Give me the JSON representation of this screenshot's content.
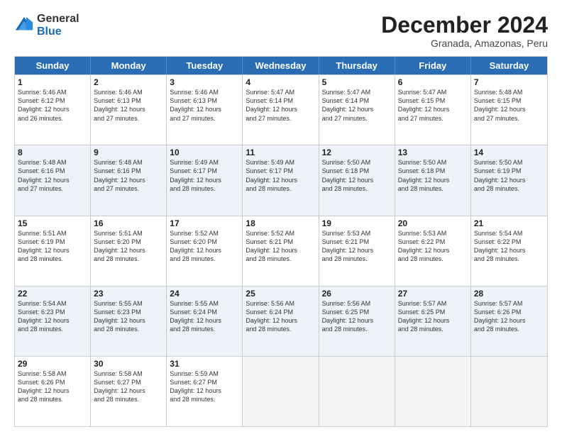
{
  "logo": {
    "general": "General",
    "blue": "Blue"
  },
  "title": "December 2024",
  "subtitle": "Granada, Amazonas, Peru",
  "header_days": [
    "Sunday",
    "Monday",
    "Tuesday",
    "Wednesday",
    "Thursday",
    "Friday",
    "Saturday"
  ],
  "weeks": [
    [
      {
        "day": "1",
        "lines": [
          "Sunrise: 5:46 AM",
          "Sunset: 6:12 PM",
          "Daylight: 12 hours",
          "and 26 minutes."
        ]
      },
      {
        "day": "2",
        "lines": [
          "Sunrise: 5:46 AM",
          "Sunset: 6:13 PM",
          "Daylight: 12 hours",
          "and 27 minutes."
        ]
      },
      {
        "day": "3",
        "lines": [
          "Sunrise: 5:46 AM",
          "Sunset: 6:13 PM",
          "Daylight: 12 hours",
          "and 27 minutes."
        ]
      },
      {
        "day": "4",
        "lines": [
          "Sunrise: 5:47 AM",
          "Sunset: 6:14 PM",
          "Daylight: 12 hours",
          "and 27 minutes."
        ]
      },
      {
        "day": "5",
        "lines": [
          "Sunrise: 5:47 AM",
          "Sunset: 6:14 PM",
          "Daylight: 12 hours",
          "and 27 minutes."
        ]
      },
      {
        "day": "6",
        "lines": [
          "Sunrise: 5:47 AM",
          "Sunset: 6:15 PM",
          "Daylight: 12 hours",
          "and 27 minutes."
        ]
      },
      {
        "day": "7",
        "lines": [
          "Sunrise: 5:48 AM",
          "Sunset: 6:15 PM",
          "Daylight: 12 hours",
          "and 27 minutes."
        ]
      }
    ],
    [
      {
        "day": "8",
        "lines": [
          "Sunrise: 5:48 AM",
          "Sunset: 6:16 PM",
          "Daylight: 12 hours",
          "and 27 minutes."
        ]
      },
      {
        "day": "9",
        "lines": [
          "Sunrise: 5:48 AM",
          "Sunset: 6:16 PM",
          "Daylight: 12 hours",
          "and 27 minutes."
        ]
      },
      {
        "day": "10",
        "lines": [
          "Sunrise: 5:49 AM",
          "Sunset: 6:17 PM",
          "Daylight: 12 hours",
          "and 28 minutes."
        ]
      },
      {
        "day": "11",
        "lines": [
          "Sunrise: 5:49 AM",
          "Sunset: 6:17 PM",
          "Daylight: 12 hours",
          "and 28 minutes."
        ]
      },
      {
        "day": "12",
        "lines": [
          "Sunrise: 5:50 AM",
          "Sunset: 6:18 PM",
          "Daylight: 12 hours",
          "and 28 minutes."
        ]
      },
      {
        "day": "13",
        "lines": [
          "Sunrise: 5:50 AM",
          "Sunset: 6:18 PM",
          "Daylight: 12 hours",
          "and 28 minutes."
        ]
      },
      {
        "day": "14",
        "lines": [
          "Sunrise: 5:50 AM",
          "Sunset: 6:19 PM",
          "Daylight: 12 hours",
          "and 28 minutes."
        ]
      }
    ],
    [
      {
        "day": "15",
        "lines": [
          "Sunrise: 5:51 AM",
          "Sunset: 6:19 PM",
          "Daylight: 12 hours",
          "and 28 minutes."
        ]
      },
      {
        "day": "16",
        "lines": [
          "Sunrise: 5:51 AM",
          "Sunset: 6:20 PM",
          "Daylight: 12 hours",
          "and 28 minutes."
        ]
      },
      {
        "day": "17",
        "lines": [
          "Sunrise: 5:52 AM",
          "Sunset: 6:20 PM",
          "Daylight: 12 hours",
          "and 28 minutes."
        ]
      },
      {
        "day": "18",
        "lines": [
          "Sunrise: 5:52 AM",
          "Sunset: 6:21 PM",
          "Daylight: 12 hours",
          "and 28 minutes."
        ]
      },
      {
        "day": "19",
        "lines": [
          "Sunrise: 5:53 AM",
          "Sunset: 6:21 PM",
          "Daylight: 12 hours",
          "and 28 minutes."
        ]
      },
      {
        "day": "20",
        "lines": [
          "Sunrise: 5:53 AM",
          "Sunset: 6:22 PM",
          "Daylight: 12 hours",
          "and 28 minutes."
        ]
      },
      {
        "day": "21",
        "lines": [
          "Sunrise: 5:54 AM",
          "Sunset: 6:22 PM",
          "Daylight: 12 hours",
          "and 28 minutes."
        ]
      }
    ],
    [
      {
        "day": "22",
        "lines": [
          "Sunrise: 5:54 AM",
          "Sunset: 6:23 PM",
          "Daylight: 12 hours",
          "and 28 minutes."
        ]
      },
      {
        "day": "23",
        "lines": [
          "Sunrise: 5:55 AM",
          "Sunset: 6:23 PM",
          "Daylight: 12 hours",
          "and 28 minutes."
        ]
      },
      {
        "day": "24",
        "lines": [
          "Sunrise: 5:55 AM",
          "Sunset: 6:24 PM",
          "Daylight: 12 hours",
          "and 28 minutes."
        ]
      },
      {
        "day": "25",
        "lines": [
          "Sunrise: 5:56 AM",
          "Sunset: 6:24 PM",
          "Daylight: 12 hours",
          "and 28 minutes."
        ]
      },
      {
        "day": "26",
        "lines": [
          "Sunrise: 5:56 AM",
          "Sunset: 6:25 PM",
          "Daylight: 12 hours",
          "and 28 minutes."
        ]
      },
      {
        "day": "27",
        "lines": [
          "Sunrise: 5:57 AM",
          "Sunset: 6:25 PM",
          "Daylight: 12 hours",
          "and 28 minutes."
        ]
      },
      {
        "day": "28",
        "lines": [
          "Sunrise: 5:57 AM",
          "Sunset: 6:26 PM",
          "Daylight: 12 hours",
          "and 28 minutes."
        ]
      }
    ],
    [
      {
        "day": "29",
        "lines": [
          "Sunrise: 5:58 AM",
          "Sunset: 6:26 PM",
          "Daylight: 12 hours",
          "and 28 minutes."
        ]
      },
      {
        "day": "30",
        "lines": [
          "Sunrise: 5:58 AM",
          "Sunset: 6:27 PM",
          "Daylight: 12 hours",
          "and 28 minutes."
        ]
      },
      {
        "day": "31",
        "lines": [
          "Sunrise: 5:59 AM",
          "Sunset: 6:27 PM",
          "Daylight: 12 hours",
          "and 28 minutes."
        ]
      },
      {
        "day": "",
        "lines": []
      },
      {
        "day": "",
        "lines": []
      },
      {
        "day": "",
        "lines": []
      },
      {
        "day": "",
        "lines": []
      }
    ]
  ]
}
